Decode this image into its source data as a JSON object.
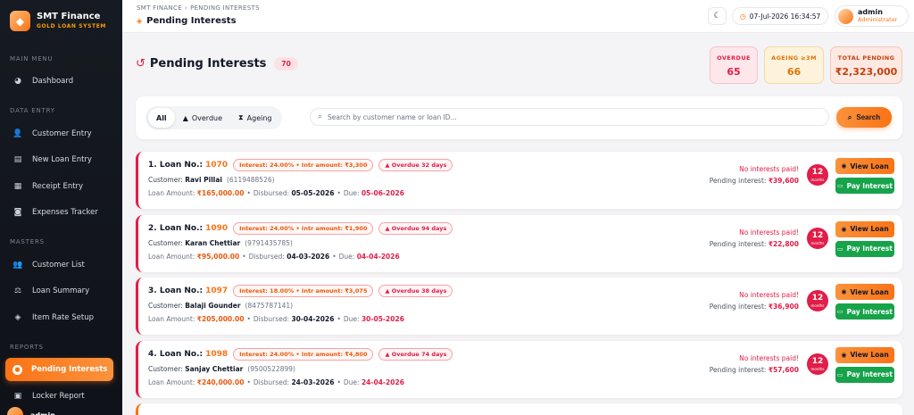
{
  "brand": {
    "title": "SMT Finance",
    "subtitle": "GOLD LOAN SYSTEM"
  },
  "sidebar": {
    "sections": [
      {
        "label": "MAIN MENU"
      },
      {
        "label": "DATA ENTRY"
      },
      {
        "label": "MASTERS"
      },
      {
        "label": "REPORTS"
      }
    ],
    "items": [
      {
        "label": "Dashboard",
        "icon": "dashboard-icon"
      },
      {
        "label": "Customer Entry",
        "icon": "user-add-icon"
      },
      {
        "label": "New Loan Entry",
        "icon": "document-icon"
      },
      {
        "label": "Receipt Entry",
        "icon": "receipt-icon"
      },
      {
        "label": "Expenses Tracker",
        "icon": "wallet-icon"
      },
      {
        "label": "Customer List",
        "icon": "users-icon"
      },
      {
        "label": "Loan Summary",
        "icon": "scale-icon"
      },
      {
        "label": "Item Rate Setup",
        "icon": "gem-icon"
      },
      {
        "label": "Pending Interests",
        "icon": "clock-icon",
        "active": true
      },
      {
        "label": "Locker Report",
        "icon": "locker-icon"
      }
    ],
    "user": "admin"
  },
  "header": {
    "breadcrumb": [
      "SMT FINANCE",
      "PENDING INTERESTS"
    ],
    "title": "Pending Interests",
    "datetime": "07-Jul-2026 16:34:57",
    "user_name": "admin",
    "user_role": "Administrator"
  },
  "page": {
    "title": "Pending Interests",
    "count": "70"
  },
  "stats": {
    "overdue": {
      "label": "OVERDUE",
      "value": "65",
      "color": "#e11d48"
    },
    "ageing": {
      "label": "AGEING ≥3M",
      "value": "66",
      "color": "#d97706"
    },
    "total": {
      "label": "TOTAL PENDING",
      "value": "₹2,323,000",
      "color": "#c2410c"
    }
  },
  "filters": {
    "tabs": [
      {
        "label": "All",
        "active": true
      },
      {
        "label": "Overdue",
        "icon": "warning-icon"
      },
      {
        "label": "Ageing",
        "icon": "hourglass-icon"
      }
    ],
    "search_placeholder": "Search by customer name or loan ID...",
    "search_button": "Search"
  },
  "labels": {
    "loan_no": "Loan No.:",
    "customer": "Customer:",
    "loan_amount": "Loan Amount:",
    "disbursed": "Disbursed:",
    "due": "Due:",
    "no_interest": "No interests paid!",
    "pending_interest": "Pending interest:",
    "months": "months",
    "view_loan": "View Loan",
    "pay_interest": "Pay Interest"
  },
  "loans": [
    {
      "index": "1.",
      "loan_no": "1070",
      "interest_chip": "Interest: 24.00% • Intr amount: ₹3,300",
      "overdue_chip": "Overdue 32 days",
      "customer": "Ravi Pillai",
      "phone": "(6119488526)",
      "loan_amount": "₹165,000.00",
      "disbursed": "05-05-2026",
      "due": "05-06-2026",
      "pending_interest": "₹39,600",
      "months": "12"
    },
    {
      "index": "2.",
      "loan_no": "1090",
      "interest_chip": "Interest: 24.00% • Intr amount: ₹1,900",
      "overdue_chip": "Overdue 94 days",
      "customer": "Karan Chettiar",
      "phone": "(9791435785)",
      "loan_amount": "₹95,000.00",
      "disbursed": "04-03-2026",
      "due": "04-04-2026",
      "pending_interest": "₹22,800",
      "months": "12"
    },
    {
      "index": "3.",
      "loan_no": "1097",
      "interest_chip": "Interest: 18.00% • Intr amount: ₹3,075",
      "overdue_chip": "Overdue 38 days",
      "customer": "Balaji Gounder",
      "phone": "(8475787141)",
      "loan_amount": "₹205,000.00",
      "disbursed": "30-04-2026",
      "due": "30-05-2026",
      "pending_interest": "₹36,900",
      "months": "12"
    },
    {
      "index": "4.",
      "loan_no": "1098",
      "interest_chip": "Interest: 24.00% • Intr amount: ₹4,800",
      "overdue_chip": "Overdue 74 days",
      "customer": "Sanjay Chettiar",
      "phone": "(9500522899)",
      "loan_amount": "₹240,000.00",
      "disbursed": "24-03-2026",
      "due": "24-04-2026",
      "pending_interest": "₹57,600",
      "months": "12"
    }
  ]
}
